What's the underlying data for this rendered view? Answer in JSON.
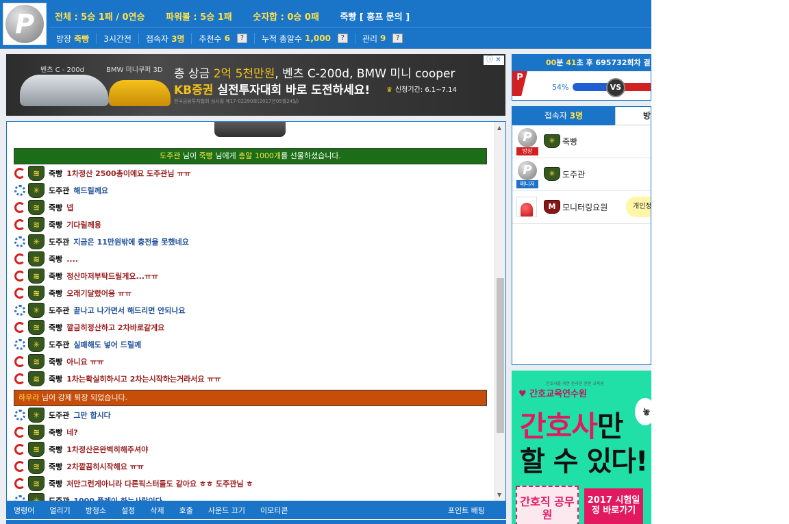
{
  "header": {
    "stats": {
      "total_label": "전체 : ",
      "total_value": "5승 1패 / 0연승",
      "power_label": "파워볼 : ",
      "power_value": "5승 1패",
      "sum_label": "숫자합 : ",
      "sum_value": "0승 0패",
      "room_title": "죽빵 [ 홍프 문의 ]"
    },
    "info": {
      "owner_label": "방장",
      "owner_value": "죽빵",
      "time": "3시간전",
      "visitors_label": "접속자",
      "visitors_value": "3명",
      "recommend_label": "추천수",
      "recommend_value": "6",
      "bullets_label": "누적 총알수",
      "bullets_value": "1,000",
      "manage_label": "관리",
      "manage_value": "9",
      "help": "?"
    }
  },
  "ad_banner": {
    "car1_label": "벤츠 C - 200d",
    "car2_label": "BMW 미니쿠퍼 3D",
    "line1_prefix": "총 상금 ",
    "line1_highlight": "2억 5천만원",
    "line1_rest": ", 벤츠 C-200d, BMW 미니 cooper",
    "line2_highlight": "KB증권",
    "line2_rest": " 실전투자대회 바로 도전하세요!",
    "period": "신청기간: 6.1~7.14",
    "fine_print": "한국금융투자협회 심사필 제17-02290호(2017년05월24일)",
    "ad_marker": "ⓘ ✕"
  },
  "chat": {
    "gift": {
      "from": "도주관",
      "mid": " 님이 ",
      "to": "죽빵",
      "mid2": " 님에게 ",
      "item": "총알 1000개",
      "end": "를 선물하셨습니다."
    },
    "kick": {
      "name": "하우라",
      "text": " 님이 강제 퇴장 되었습니다."
    },
    "messages_before": [
      {
        "nick": "죽빵",
        "text": "1차정산 2500총이에요 도주관님 ㅠㅠ",
        "side": "owner"
      },
      {
        "nick": "도주관",
        "text": "해드릴께요",
        "side": "manager"
      },
      {
        "nick": "죽빵",
        "text": "넵",
        "side": "owner"
      },
      {
        "nick": "죽빵",
        "text": "기다릴께용",
        "side": "owner"
      },
      {
        "nick": "도주관",
        "text": "지금은 11만원밖에 충전을 못했네요",
        "side": "manager"
      },
      {
        "nick": "죽빵",
        "text": "....",
        "side": "owner"
      },
      {
        "nick": "죽빵",
        "text": "정산마저부탁드릴게요...ㅠㅠ",
        "side": "owner"
      },
      {
        "nick": "죽빵",
        "text": "오래기달렸어용 ㅠㅠ",
        "side": "owner"
      },
      {
        "nick": "도주관",
        "text": "끝나고 나가면서 해드리면 안되나요",
        "side": "manager"
      },
      {
        "nick": "죽빵",
        "text": "깔금히정산하고 2차바로갈게요",
        "side": "owner"
      },
      {
        "nick": "도주관",
        "text": "실패해도 넣어 드릴께",
        "side": "manager"
      },
      {
        "nick": "죽빵",
        "text": "아니요 ㅠㅠ",
        "side": "owner"
      },
      {
        "nick": "죽빵",
        "text": "1차는확실히하시고 2차는시작하는거라서요 ㅠㅠ",
        "side": "owner"
      }
    ],
    "messages_after": [
      {
        "nick": "도주관",
        "text": "그만 합시다",
        "side": "manager"
      },
      {
        "nick": "죽빵",
        "text": "네?",
        "side": "owner"
      },
      {
        "nick": "죽빵",
        "text": "1차정산은완벽히해주셔야",
        "side": "owner"
      },
      {
        "nick": "죽빵",
        "text": "2차깔끔히시작해요 ㅠㅠ",
        "side": "owner"
      },
      {
        "nick": "죽빵",
        "text": "저만그런게아니라 다른픽스터들도 같아요 ㅎㅎ 도주관님 ㅎ",
        "side": "owner"
      },
      {
        "nick": "도주관",
        "text": "1000 플레이 하는사람이다",
        "side": "manager"
      }
    ]
  },
  "toolbar": {
    "items": [
      "명령어",
      "얼리기",
      "방청소",
      "설정",
      "삭제",
      "호출",
      "사운드 끄기",
      "이모티콘"
    ],
    "point_bet": "포인트 배팅"
  },
  "vs_widget": {
    "countdown_min": "00",
    "countdown_min_unit": "분 ",
    "countdown_sec": "41",
    "countdown_text": "초 후 695732회차 결",
    "p_label": "P",
    "percent": "54%",
    "percent_value": 0.54,
    "vs": "VS"
  },
  "users": {
    "tab_label": "접속자 ",
    "tab_count": "3명",
    "tab2_label": "방",
    "list": [
      {
        "name": "죽빵",
        "tag": "방장",
        "type": "owner"
      },
      {
        "name": "도주관",
        "tag": "매니저",
        "type": "manager"
      },
      {
        "name": "모니터링요원",
        "tag": "",
        "type": "monitor",
        "bubble": "개인정"
      }
    ]
  },
  "ad2": {
    "logo_small": "간호사를 위한 온라인 전문 교육원",
    "logo": "간호교육연수원",
    "headline1_a": "간호사",
    "headline1_b": "만",
    "headline2": "할 수 있다!",
    "card1": "간호직 공무원",
    "card2": "2017 시험일정 바로가기",
    "deco": "놓"
  },
  "colors": {
    "primary": "#1a74c8",
    "accent_yellow": "#ffe24a",
    "owner_text": "#9a1d1d",
    "manager_text": "#1d4f9a",
    "gift_bg": "#1b6e17",
    "kick_bg": "#c64e0a"
  }
}
